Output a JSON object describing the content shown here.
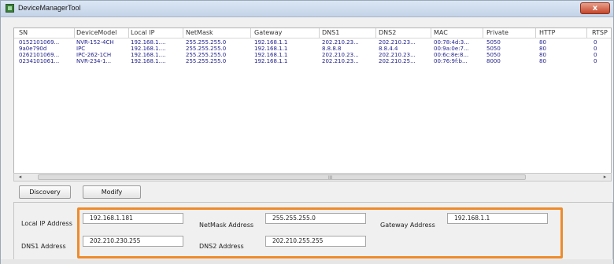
{
  "window": {
    "title": "DeviceManagerTool",
    "close_glyph": "x"
  },
  "table": {
    "columns": [
      "SN",
      "DeviceModel",
      "Local IP",
      "NetMask",
      "Gateway",
      "DNS1",
      "DNS2",
      "MAC",
      "Private",
      "HTTP",
      "RTSP"
    ],
    "rows": [
      [
        "0152101069...",
        "NVR-152-4CH",
        "192.168.1....",
        "255.255.255.0",
        "192.168.1.1",
        "202.210.23...",
        "202.210.23...",
        "00:78:4d:3...",
        "5050",
        "80",
        "0"
      ],
      [
        "9a0e790d",
        "IPC",
        "192.168.1....",
        "255.255.255.0",
        "192.168.1.1",
        "8.8.8.8",
        "8.8.4.4",
        "00:9a:0e:7...",
        "5050",
        "80",
        "0"
      ],
      [
        "0262101069...",
        "IPC-262-1CH",
        "192.168.1....",
        "255.255.255.0",
        "192.168.1.1",
        "202.210.23...",
        "202.210.23...",
        "00:6c:8e:8...",
        "5050",
        "80",
        "0"
      ],
      [
        "0234101061...",
        "NVR-234-1...",
        "192.168.1....",
        "255.255.255.0",
        "192.168.1.1",
        "202.210.23...",
        "202.210.25...",
        "00:76:9f:b...",
        "8000",
        "80",
        "0"
      ]
    ]
  },
  "scrollbar": {
    "left_glyph": "◂",
    "right_glyph": "▸",
    "grip": "III"
  },
  "buttons": {
    "discovery": "Discovery",
    "modify": "Modify"
  },
  "form": {
    "local_ip_label": "Local IP Address",
    "local_ip_value": "192.168.1.181",
    "netmask_label": "NetMask Address",
    "netmask_value": "255.255.255.0",
    "gateway_label": "Gateway Address",
    "gateway_value": "192.168.1.1",
    "dns1_label": "DNS1 Address",
    "dns1_value": "202.210.230.255",
    "dns2_label": "DNS2 Address",
    "dns2_value": "202.210.255.255"
  },
  "colors": {
    "highlight": "#ef8a2a",
    "row_text": "#1e1e8c"
  }
}
